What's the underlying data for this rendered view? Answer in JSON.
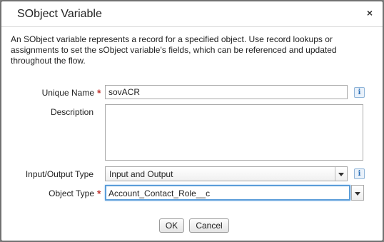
{
  "dialog": {
    "title": "SObject Variable",
    "close_glyph": "×",
    "description": "An SObject variable represents a record for a specified object. Use record lookups or assignments to set the sObject variable's fields, which can be referenced and updated throughout the flow."
  },
  "form": {
    "unique_name": {
      "label": "Unique Name",
      "required_mark": "*",
      "value": "sovACR",
      "info_icon": "i"
    },
    "description": {
      "label": "Description",
      "value": ""
    },
    "io_type": {
      "label": "Input/Output Type",
      "selected": "Input and Output",
      "info_icon": "i"
    },
    "object_type": {
      "label": "Object Type",
      "required_mark": "*",
      "value": "Account_Contact_Role__c"
    }
  },
  "buttons": {
    "ok": "OK",
    "cancel": "Cancel"
  },
  "colors": {
    "required": "#c23934",
    "focus_border": "#5b9dd9",
    "info": "#2a6fb6"
  }
}
